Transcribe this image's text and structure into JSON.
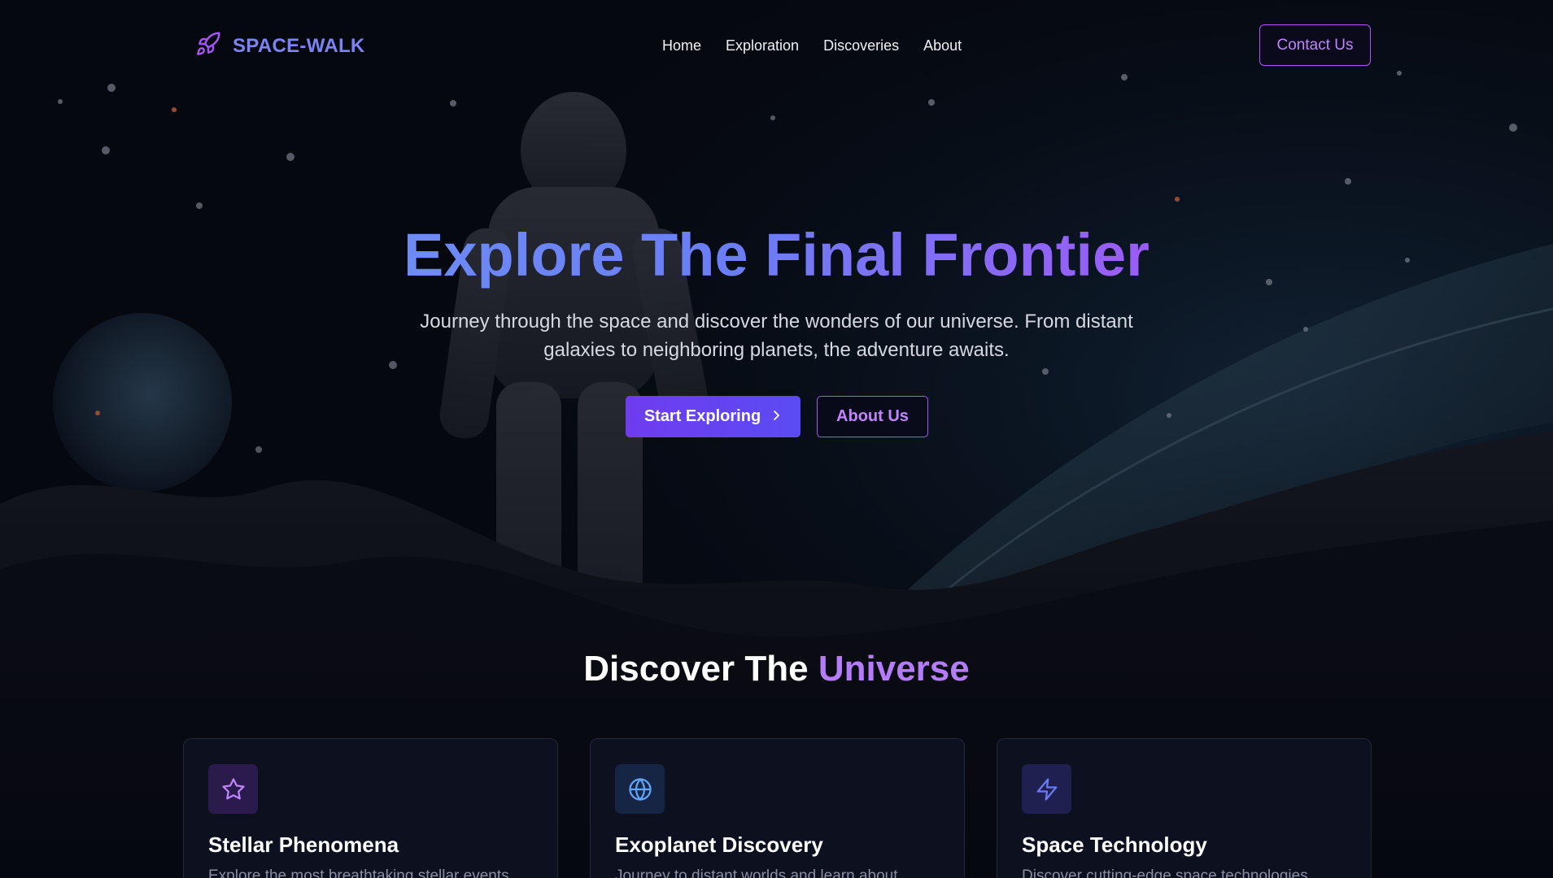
{
  "brand": {
    "name": "SPACE-WALK",
    "icon": "rocket-icon",
    "color": "#7c83f3"
  },
  "nav": {
    "items": [
      {
        "label": "Home"
      },
      {
        "label": "Exploration"
      },
      {
        "label": "Discoveries"
      },
      {
        "label": "About"
      }
    ],
    "contact_label": "Contact Us"
  },
  "hero": {
    "title": "Explore The Final Frontier",
    "subtitle_line1": "Journey through the space and discover the wonders of our universe. From distant",
    "subtitle_line2": "galaxies to neighboring planets, the adventure awaits.",
    "primary_label": "Start Exploring",
    "primary_icon": "chevron-right-icon",
    "secondary_label": "About Us"
  },
  "section": {
    "title_plain": "Discover The",
    "title_accent": "Universe"
  },
  "cards": [
    {
      "title": "Stellar Phenomena",
      "desc": "Explore the most breathtaking stellar events",
      "icon": "star-icon",
      "icon_color": "#c084fc",
      "icon_bg": "#2b1b4d"
    },
    {
      "title": "Exoplanet Discovery",
      "desc": "Journey to distant worlds and learn about",
      "icon": "globe-icon",
      "icon_color": "#60a5fa",
      "icon_bg": "#172544"
    },
    {
      "title": "Space Technology",
      "desc": "Discover cutting-edge space technologies",
      "icon": "lightning-icon",
      "icon_color": "#6d79f3",
      "icon_bg": "#1e2150"
    }
  ],
  "colors": {
    "background": "#05070f",
    "accent_purple": "#a855f7",
    "accent_blue": "#6d8bf5",
    "button_gradient_start": "#6f3cf0",
    "button_gradient_end": "#5b4bf2"
  }
}
